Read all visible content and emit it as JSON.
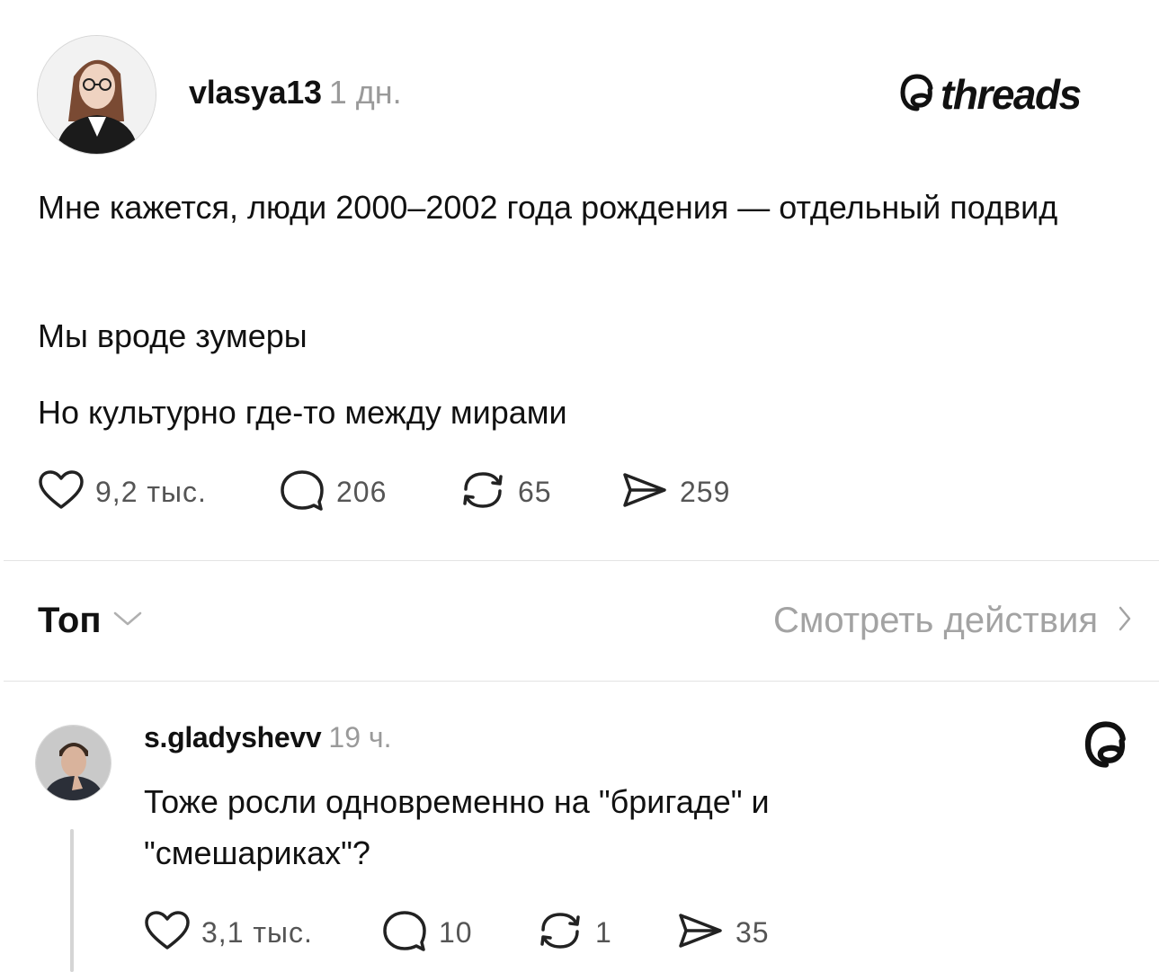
{
  "post": {
    "username": "vlasya13",
    "time": "1 дн.",
    "brand": "threads",
    "paragraphs": [
      "Мне кажется, люди 2000–2002 года рождения — отдельный подвид",
      "Мы вроде зумеры",
      "Но культурно где-то между мирами"
    ],
    "stats": {
      "likes": "9,2 тыс.",
      "replies": "206",
      "reposts": "65",
      "shares": "259"
    }
  },
  "replies_header": {
    "sort_label": "Топ",
    "activity_label": "Смотреть действия"
  },
  "reply": {
    "username": "s.gladyshevv",
    "time": "19 ч.",
    "text": "Тоже росли одновременно на \"бригаде\" и \"смешариках\"?",
    "stats": {
      "likes": "3,1 тыс.",
      "replies": "10",
      "reposts": "1",
      "shares": "35"
    }
  },
  "icons": {
    "like": "heart-icon",
    "reply": "speech-bubble-icon",
    "repost": "repost-icon",
    "share": "send-icon",
    "brand": "threads-logo-icon"
  }
}
